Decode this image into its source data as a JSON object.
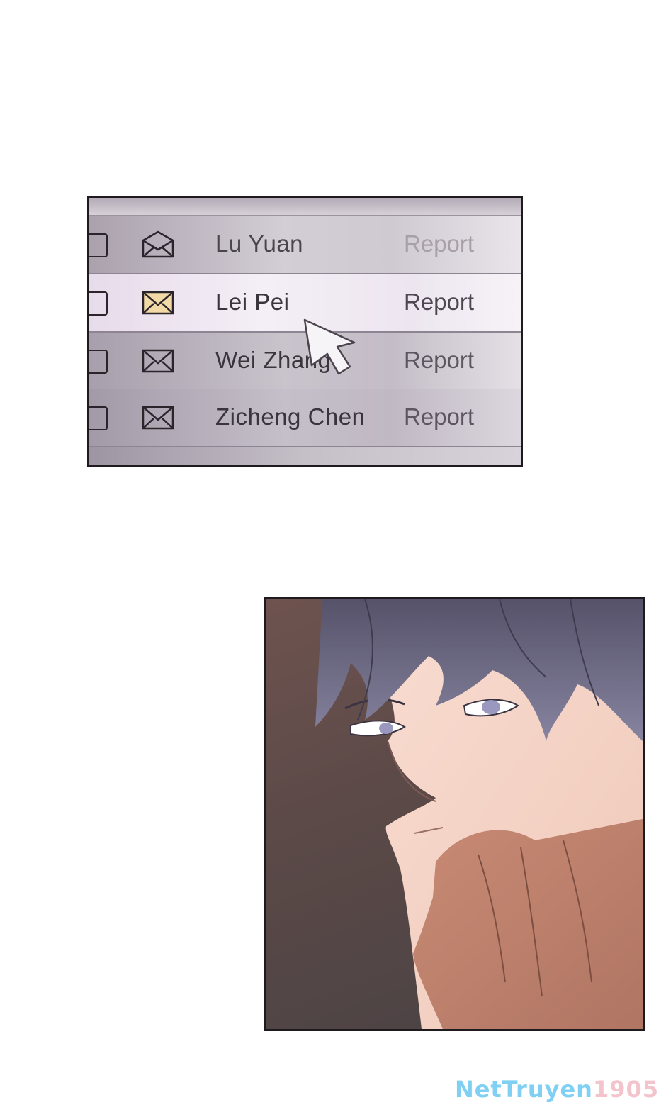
{
  "email_list": {
    "rows": [
      {
        "sender": "Lu Yuan",
        "subject": "Report",
        "icon": "envelope-icon",
        "state": "read"
      },
      {
        "sender": "Lei Pei",
        "subject": "Report",
        "icon": "envelope-icon",
        "state": "highlighted"
      },
      {
        "sender": "Wei Zhang",
        "subject": "Report",
        "icon": "envelope-icon",
        "state": "read"
      },
      {
        "sender": "Zicheng Chen",
        "subject": "Report",
        "icon": "envelope-icon",
        "state": "read"
      }
    ],
    "highlight_envelope_color": "#f3d9a6",
    "cursor_icon": "mouse-pointer-icon"
  },
  "comic_panel": {
    "hair_color": "#6f6b80",
    "skin_color": "#f4d3c6",
    "background_color": "#5a4947"
  },
  "watermark": {
    "part1": "NetTruyen",
    "part2": "1905"
  }
}
